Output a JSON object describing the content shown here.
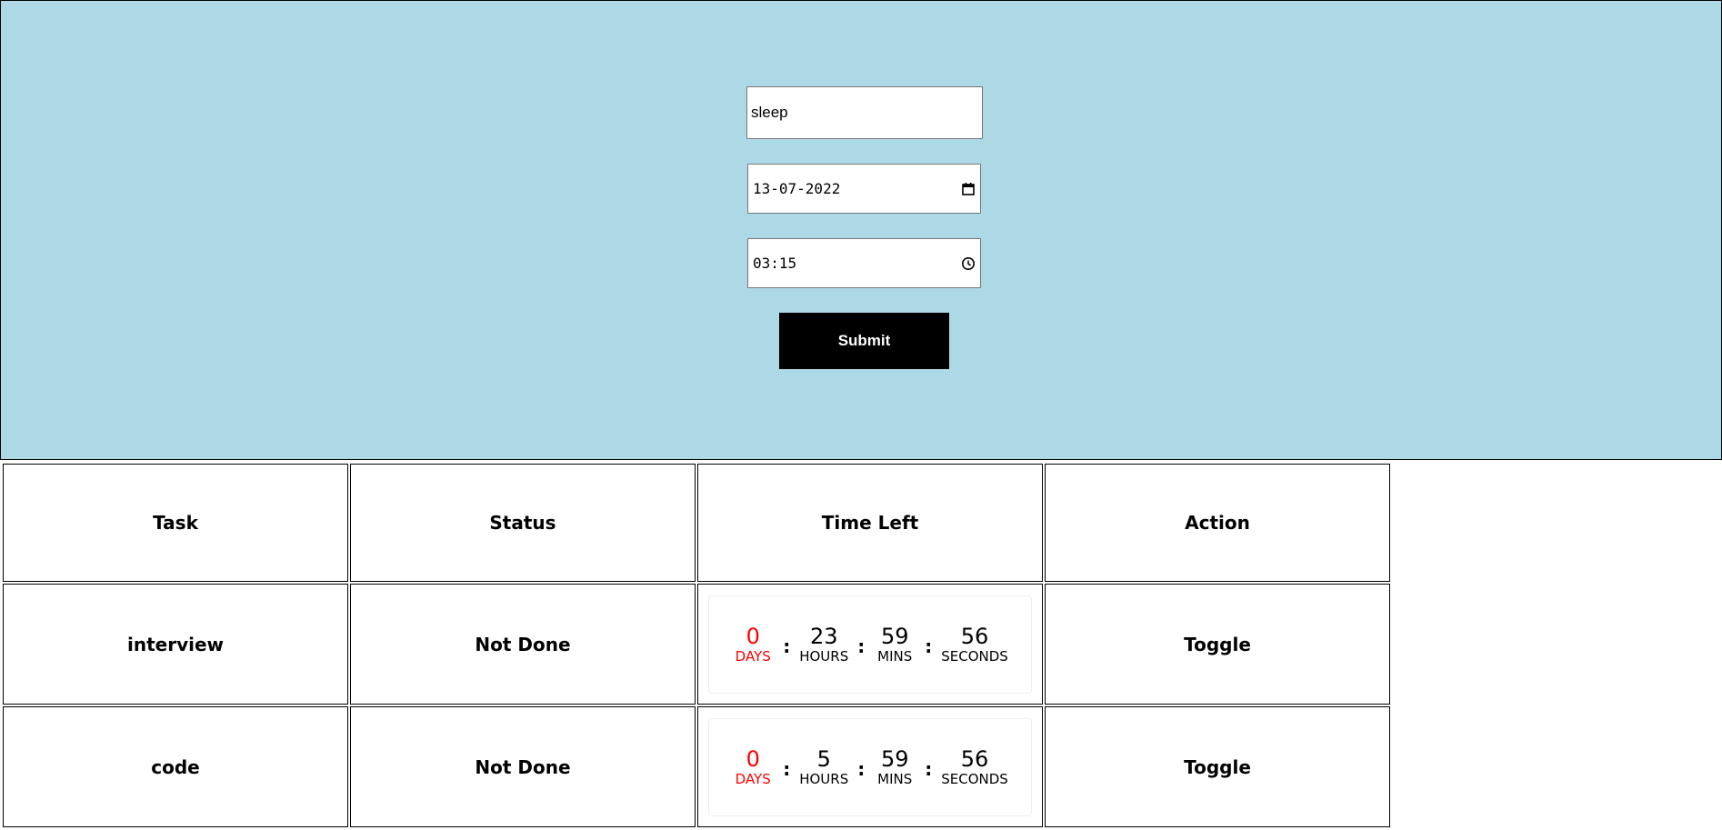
{
  "form": {
    "task_value": "sleep",
    "date_value": "13-07-2022",
    "time_value": "03:15",
    "submit_label": "Submit"
  },
  "table": {
    "headers": [
      "Task",
      "Status",
      "Time Left",
      "Action"
    ],
    "rows": [
      {
        "task": "interview",
        "status": "Not Done",
        "countdown": {
          "days": "0",
          "hours": "23",
          "mins": "59",
          "seconds": "56",
          "days_label": "DAYS",
          "hours_label": "HOURS",
          "mins_label": "MINS",
          "seconds_label": "SECONDS"
        },
        "action": "Toggle"
      },
      {
        "task": "code",
        "status": "Not Done",
        "countdown": {
          "days": "0",
          "hours": "5",
          "mins": "59",
          "seconds": "56",
          "days_label": "DAYS",
          "hours_label": "HOURS",
          "mins_label": "MINS",
          "seconds_label": "SECONDS"
        },
        "action": "Toggle"
      }
    ],
    "separator": ":"
  },
  "colors": {
    "panel_bg": "#add8e6",
    "status_red": "#ff0000",
    "button_bg": "#000000"
  },
  "icons": {
    "date_input": "calendar-icon",
    "time_input": "clock-icon"
  }
}
